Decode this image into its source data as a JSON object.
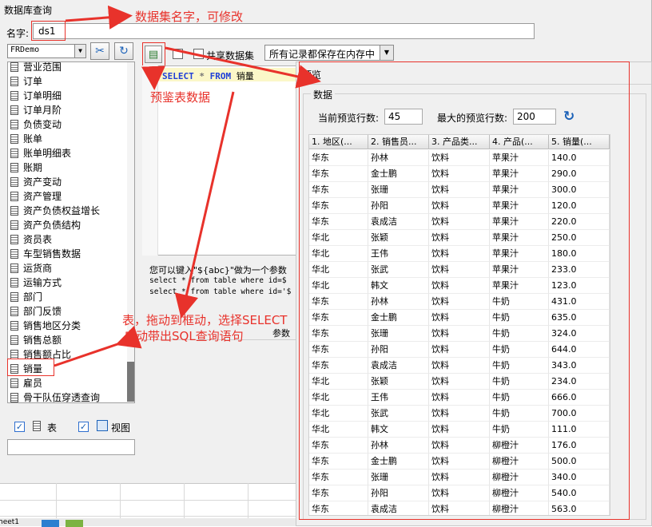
{
  "window_title": "数据库查询",
  "name_label": "名字:",
  "name_value": "ds1",
  "db_select": "FRDemo",
  "share_label": "共享数据集",
  "memory_option": "所有记录都保存在内存中",
  "tree_items": [
    "营业范围",
    "订单",
    "订单明细",
    "订单月阶",
    "负债变动",
    "账单",
    "账单明细表",
    "账期",
    "资产变动",
    "资产管理",
    "资产负债权益增长",
    "资产负债结构",
    "资员表",
    "车型销售数据",
    "运货商",
    "运输方式",
    "部门",
    "部门反馈",
    "销售地区分类",
    "销售总额",
    "销售额占比",
    "销量",
    "雇员",
    "骨干队伍穿透查询"
  ],
  "filter": {
    "table_label": "表",
    "view_label": "视图"
  },
  "sql": {
    "line_no": "1",
    "select": "SELECT",
    "star": "*",
    "from": "FROM",
    "table": "销量"
  },
  "help": {
    "line1": "您可以键入\"${abc}\"做为一个参数",
    "line2": "select * from table where id=$",
    "line3": "select * from table where id='$",
    "params_label": "参数"
  },
  "preview": {
    "title": "预览",
    "group_label": "数据",
    "current_rows_label": "当前预览行数:",
    "current_rows": "45",
    "max_rows_label": "最大的预览行数:",
    "max_rows": "200",
    "columns": [
      "1. 地区(...",
      "2. 销售员...",
      "3. 产品类...",
      "4. 产品(...",
      "5. 销量(..."
    ],
    "rows": [
      [
        "华东",
        "孙林",
        "饮料",
        "苹果汁",
        "140.0"
      ],
      [
        "华东",
        "金士鹏",
        "饮料",
        "苹果汁",
        "290.0"
      ],
      [
        "华东",
        "张珊",
        "饮料",
        "苹果汁",
        "300.0"
      ],
      [
        "华东",
        "孙阳",
        "饮料",
        "苹果汁",
        "120.0"
      ],
      [
        "华东",
        "袁成洁",
        "饮料",
        "苹果汁",
        "220.0"
      ],
      [
        "华北",
        "张颖",
        "饮料",
        "苹果汁",
        "250.0"
      ],
      [
        "华北",
        "王伟",
        "饮料",
        "苹果汁",
        "180.0"
      ],
      [
        "华北",
        "张武",
        "饮料",
        "苹果汁",
        "233.0"
      ],
      [
        "华北",
        "韩文",
        "饮料",
        "苹果汁",
        "123.0"
      ],
      [
        "华东",
        "孙林",
        "饮料",
        "牛奶",
        "431.0"
      ],
      [
        "华东",
        "金士鹏",
        "饮料",
        "牛奶",
        "635.0"
      ],
      [
        "华东",
        "张珊",
        "饮料",
        "牛奶",
        "324.0"
      ],
      [
        "华东",
        "孙阳",
        "饮料",
        "牛奶",
        "644.0"
      ],
      [
        "华东",
        "袁成洁",
        "饮料",
        "牛奶",
        "343.0"
      ],
      [
        "华北",
        "张颖",
        "饮料",
        "牛奶",
        "234.0"
      ],
      [
        "华北",
        "王伟",
        "饮料",
        "牛奶",
        "666.0"
      ],
      [
        "华北",
        "张武",
        "饮料",
        "牛奶",
        "700.0"
      ],
      [
        "华北",
        "韩文",
        "饮料",
        "牛奶",
        "111.0"
      ],
      [
        "华东",
        "孙林",
        "饮料",
        "柳橙汁",
        "176.0"
      ],
      [
        "华东",
        "金士鹏",
        "饮料",
        "柳橙汁",
        "500.0"
      ],
      [
        "华东",
        "张珊",
        "饮料",
        "柳橙汁",
        "340.0"
      ],
      [
        "华东",
        "孙阳",
        "饮料",
        "柳橙汁",
        "540.0"
      ],
      [
        "华东",
        "袁成洁",
        "饮料",
        "柳橙汁",
        "563.0"
      ]
    ]
  },
  "annotations": {
    "dataset_name": "数据集名字，可修改",
    "preview_data": "预鉴表数据",
    "drag_line1": "表，拖动到框动，选择SELECT",
    "drag_line2": "自动带出SQL查询语句"
  },
  "sheet_tab": "heet1",
  "colors": {
    "annotation": "#e8322b",
    "keyword": "#1f3fd8",
    "icon_blue": "#1c62b8"
  }
}
